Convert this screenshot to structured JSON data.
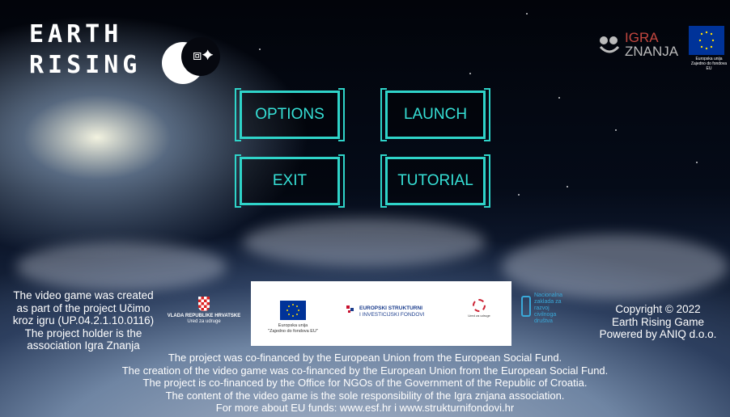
{
  "game": {
    "title_line1": "EARTH",
    "title_line2": "RISING"
  },
  "partner_logo": {
    "line1": "IGRA",
    "line2": "ZNANJA"
  },
  "eu_flag_caption": {
    "line1": "Europska unija",
    "line2": "Zajedno do fondova EU"
  },
  "menu": {
    "options_label": "OPTIONS",
    "launch_label": "LAUNCH",
    "exit_label": "EXIT",
    "tutorial_label": "TUTORIAL"
  },
  "project_info": {
    "line1": "The video game was created",
    "line2": "as part of the project Učimo",
    "line3": "kroz igru (UP.04.2.1.10.0116)",
    "line4": "The project holder is the",
    "line5": "association Igra Znanja"
  },
  "copyright": {
    "line1": "Copyright © 2022",
    "line2": "Earth Rising Game",
    "line3": "Powered by ANIQ d.o.o."
  },
  "sponsors": {
    "vlada_line1": "VLADA REPUBLIKE HRVATSKE",
    "vlada_line2": "Ured za udruge",
    "eu_line1": "Europska unija",
    "eu_line2": "\"Zajedno do fondova EU\"",
    "esif_line1": "EUROPSKI STRUKTURNI",
    "esif_line2": "I INVESTICIJSKI FONDOVI",
    "ured_text": "Ured za udruge",
    "zaklada_line1": "Nacionalna",
    "zaklada_line2": "zaklada za",
    "zaklada_line3": "razvoj",
    "zaklada_line4": "civilnoga",
    "zaklada_line5": "društva"
  },
  "footer": {
    "line1": "The project was co-financed by the European Union from the European Social Fund.",
    "line2": "The creation of the video game was co-financed by the European Union from the European Social Fund.",
    "line3": "The project is co-financed by the Office for NGOs of the Government of the Republic of Croatia.",
    "line4": "The content of the video game is the sole responsibility of the Igra znjana association.",
    "line5": "For more about EU funds: www.esf.hr i www.strukturnifondovi.hr"
  },
  "colors": {
    "accent": "#2fd4c9",
    "eu_blue": "#003399"
  }
}
